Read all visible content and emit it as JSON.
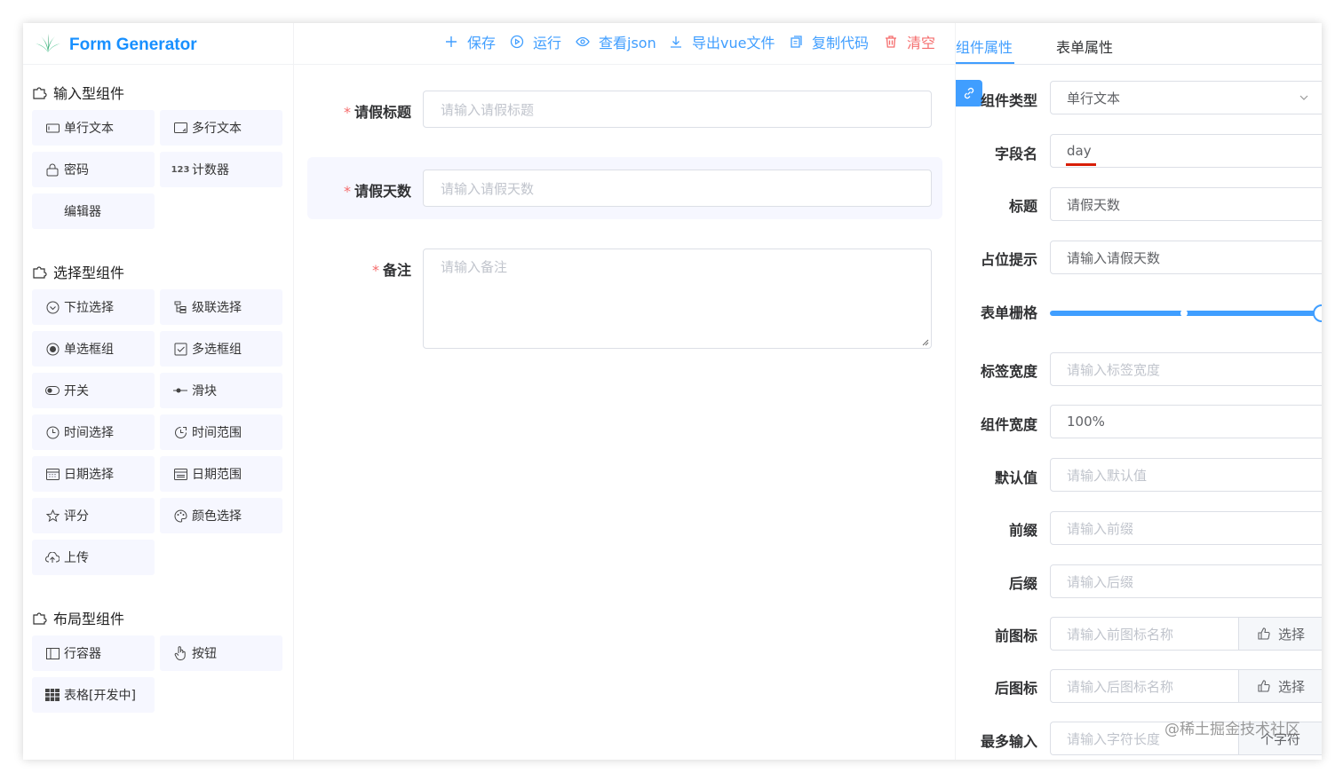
{
  "app": {
    "title": "Form Generator",
    "accent": "#409eff",
    "danger": "#f56c6c"
  },
  "left": {
    "groups": [
      {
        "title": "输入型组件",
        "items": [
          {
            "label": "单行文本",
            "icon": "input-icon"
          },
          {
            "label": "多行文本",
            "icon": "textarea-icon"
          },
          {
            "label": "密码",
            "icon": "password-icon"
          },
          {
            "label": "计数器",
            "icon": "number-icon"
          },
          {
            "label": "编辑器",
            "icon": ""
          }
        ]
      },
      {
        "title": "选择型组件",
        "items": [
          {
            "label": "下拉选择",
            "icon": "select-icon"
          },
          {
            "label": "级联选择",
            "icon": "cascader-icon"
          },
          {
            "label": "单选框组",
            "icon": "radio-icon"
          },
          {
            "label": "多选框组",
            "icon": "checkbox-icon"
          },
          {
            "label": "开关",
            "icon": "switch-icon"
          },
          {
            "label": "滑块",
            "icon": "slider-icon"
          },
          {
            "label": "时间选择",
            "icon": "time-icon"
          },
          {
            "label": "时间范围",
            "icon": "time-range-icon"
          },
          {
            "label": "日期选择",
            "icon": "date-icon"
          },
          {
            "label": "日期范围",
            "icon": "date-range-icon"
          },
          {
            "label": "评分",
            "icon": "rate-icon"
          },
          {
            "label": "颜色选择",
            "icon": "color-icon"
          },
          {
            "label": "上传",
            "icon": "upload-icon"
          }
        ]
      },
      {
        "title": "布局型组件",
        "items": [
          {
            "label": "行容器",
            "icon": "row-icon"
          },
          {
            "label": "按钮",
            "icon": "button-icon"
          },
          {
            "label": "表格[开发中]",
            "icon": "table-icon"
          }
        ]
      }
    ]
  },
  "toolbar": {
    "save": "保存",
    "run": "运行",
    "view_json": "查看json",
    "export_vue": "导出vue文件",
    "copy_code": "复制代码",
    "clear": "清空"
  },
  "form": {
    "fields": [
      {
        "label": "请假标题",
        "required": "*",
        "placeholder": "请输入请假标题"
      },
      {
        "label": "请假天数",
        "required": "*",
        "placeholder": "请输入请假天数"
      },
      {
        "label": "备注",
        "required": "*",
        "placeholder": "请输入备注"
      }
    ]
  },
  "right": {
    "tabs": [
      "组件属性",
      "表单属性"
    ],
    "props": {
      "type_label": "组件类型",
      "type_value": "单行文本",
      "field_label": "字段名",
      "field_value": "day",
      "title_label": "标题",
      "title_value": "请假天数",
      "placeholder_label": "占位提示",
      "placeholder_value": "请输入请假天数",
      "span_label": "表单栅格",
      "span_value": 24,
      "label_width_label": "标签宽度",
      "label_width_ph": "请输入标签宽度",
      "width_label": "组件宽度",
      "width_value": "100%",
      "default_label": "默认值",
      "default_ph": "请输入默认值",
      "prefix_label": "前缀",
      "prefix_ph": "请输入前缀",
      "suffix_label": "后缀",
      "suffix_ph": "请输入后缀",
      "prefix_icon_label": "前图标",
      "prefix_icon_ph": "请输入前图标名称",
      "suffix_icon_label": "后图标",
      "suffix_icon_ph": "请输入后图标名称",
      "choose": "选择",
      "maxlength_label": "最多输入",
      "maxlength_ph": "请输入字符长度",
      "maxlength_unit": "个字符"
    }
  },
  "watermark": "@稀土掘金技术社区"
}
